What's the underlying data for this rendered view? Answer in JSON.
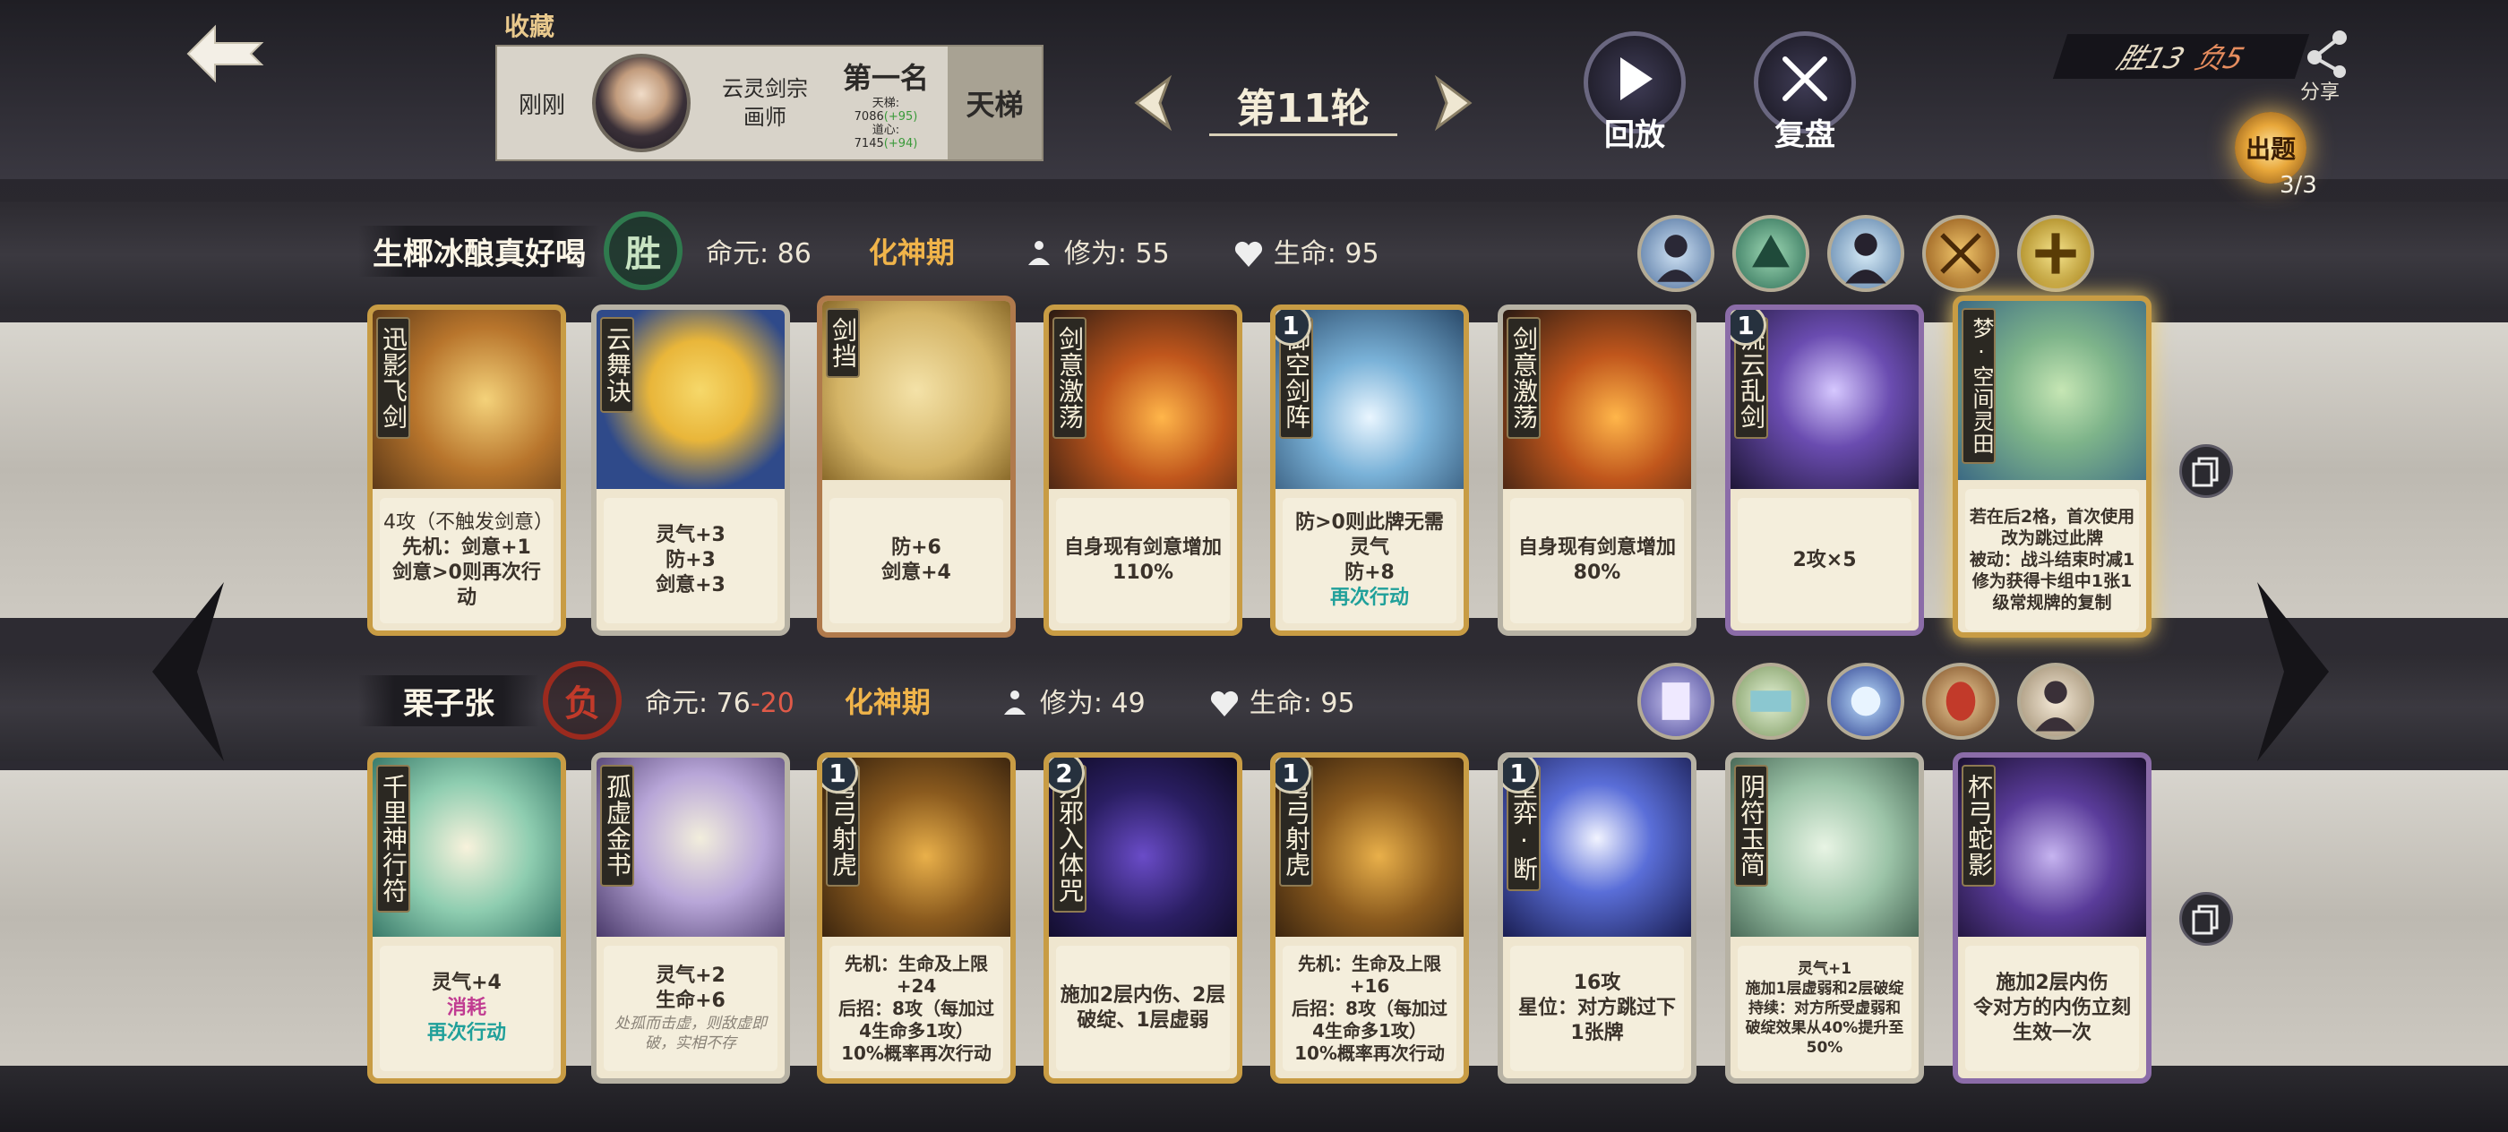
{
  "header": {
    "favorite_label": "收藏",
    "replay": {
      "time": "刚刚",
      "sect": "云灵剑宗",
      "role": "画师",
      "rank": "第一名",
      "ladder_label": "天梯:",
      "ladder_score": "7086",
      "ladder_delta": "(+95)",
      "mind_label": "道心:",
      "mind_score": "7145",
      "mind_delta": "(+94)",
      "mode": "天梯"
    },
    "round_label": "第11轮",
    "replay_btn": "回放",
    "review_btn": "复盘",
    "score_win": "胜13",
    "score_lose": "负5",
    "share_label": "分享",
    "quiz_label": "出题",
    "quiz_count": "3/3"
  },
  "player1": {
    "name": "生椰冰酿真好喝",
    "result": "胜",
    "life_core_label": "命元:",
    "life_core": "86",
    "realm": "化神期",
    "cultivation_label": "修为:",
    "cultivation": "55",
    "hp_label": "生命:",
    "hp": "95"
  },
  "player2": {
    "name": "栗子张",
    "result": "负",
    "life_core_label": "命元:",
    "life_core": "76",
    "life_core_delta": "-20",
    "realm": "化神期",
    "cultivation_label": "修为:",
    "cultivation": "49",
    "hp_label": "生命:",
    "hp": "95"
  },
  "cards_row1": [
    {
      "name": "迅影飞剑",
      "lines": [
        "4攻（不触发剑意）",
        "先机：剑意+1",
        "剑意>0则再次行动"
      ]
    },
    {
      "name": "云舞诀",
      "lines": [
        "灵气+3",
        "防+3",
        "剑意+3"
      ]
    },
    {
      "name": "剑挡",
      "lines": [
        "防+6",
        "剑意+4"
      ]
    },
    {
      "name": "剑意激荡",
      "lines": [
        "自身现有剑意增加110%"
      ]
    },
    {
      "name": "御空剑阵",
      "level": "1",
      "lines": [
        "防>0则此牌无需灵气",
        "防+8",
        "再次行动"
      ]
    },
    {
      "name": "剑意激荡",
      "lines": [
        "自身现有剑意增加80%"
      ]
    },
    {
      "name": "流云乱剑",
      "level": "1",
      "lines": [
        "2攻×5"
      ]
    },
    {
      "name": "梦·空间灵田",
      "lines": [
        "若在后2格，首次使用改为跳过此牌",
        "被动：战斗结束时减1修为获得卡组中1张1级常规牌的复制"
      ]
    }
  ],
  "cards_row2": [
    {
      "name": "千里神行符",
      "lines": [
        "灵气+4",
        "消耗",
        "再次行动"
      ]
    },
    {
      "name": "孤虚金书",
      "lines": [
        "灵气+2",
        "生命+6",
        "处孤而击虚，则敌虚即破，实相不存"
      ]
    },
    {
      "name": "弯弓射虎",
      "level": "1",
      "lines": [
        "先机：生命及上限+24",
        "后招：8攻（每加过4生命多1攻）",
        "10%概率再次行动"
      ]
    },
    {
      "name": "万邪入体咒",
      "level": "2",
      "lines": [
        "施加2层内伤、2层破绽、1层虚弱"
      ]
    },
    {
      "name": "弯弓射虎",
      "level": "1",
      "lines": [
        "先机：生命及上限+16",
        "后招：8攻（每加过4生命多1攻）",
        "10%概率再次行动"
      ]
    },
    {
      "name": "星弈·断",
      "level": "1",
      "lines": [
        "16攻",
        "星位：对方跳过下1张牌"
      ]
    },
    {
      "name": "阴符玉简",
      "lines": [
        "灵气+1",
        "施加1层虚弱和2层破绽",
        "持续：对方所受虚弱和破绽效果从40%提升至50%"
      ]
    },
    {
      "name": "杯弓蛇影",
      "lines": [
        "施加2层内伤",
        "令对方的内伤立刻生效一次"
      ]
    }
  ]
}
